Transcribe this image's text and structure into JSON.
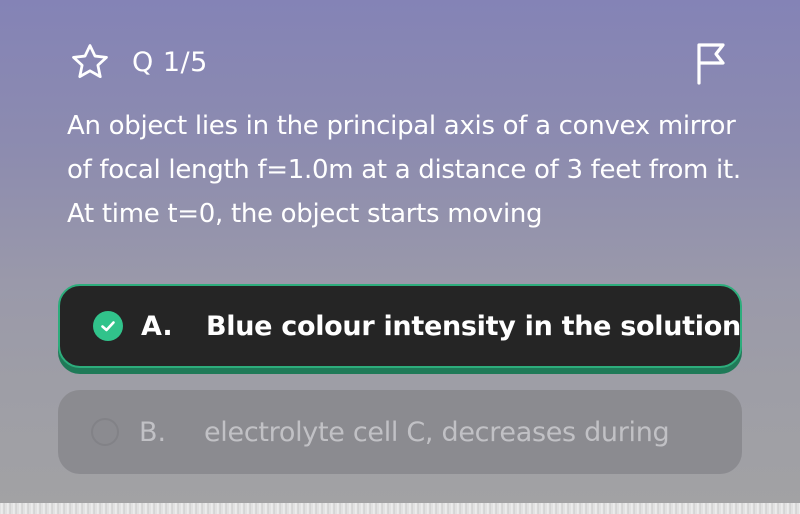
{
  "header": {
    "question_counter": "Q 1/5",
    "favorite_icon": "star-outline-icon",
    "report_icon": "flag-outline-icon"
  },
  "question": {
    "text": "An object lies in the principal axis of a convex mirror of focal length f=1.0m at a distance of 3 feet from it. At time t=0, the object starts moving"
  },
  "options": [
    {
      "letter": "A.",
      "text": "Blue colour intensity in the solution",
      "state": "selected",
      "icon": "checkmark-circle-icon"
    },
    {
      "letter": "B.",
      "text": "electrolyte cell C, decreases during",
      "state": "unselected",
      "icon": "radio-circle-icon"
    }
  ],
  "colors": {
    "background_top": "#8483b6",
    "background_bottom": "#a2a2a4",
    "selected_option_bg": "#252525",
    "selected_border": "#2dad7c",
    "check_green": "#31c38b",
    "unselected_option_bg": "#8b8b90"
  }
}
